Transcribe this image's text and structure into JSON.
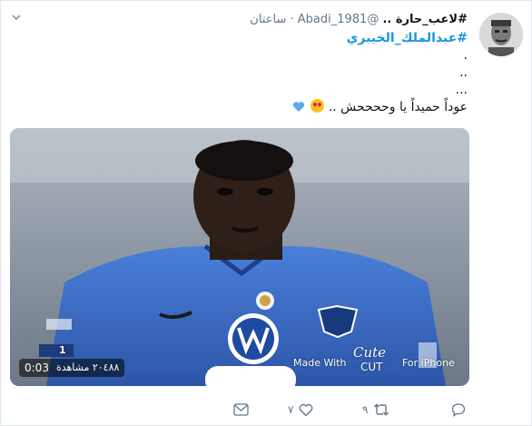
{
  "tweet": {
    "author_name": "#لاعب_حارة ..",
    "handle": "@Abadi_1981",
    "separator": "·",
    "time": "ساعتان",
    "hashtag": "#عبدالملك_الخيبري",
    "line_dot1": ".",
    "line_dot2": "..",
    "line_dot3": "...",
    "message": "عوداً حميداً يا وححححش ..",
    "media": {
      "duration": "0:03",
      "views": "٢٠٤٨٨ مشاهدة",
      "watermark_made_with": "Made With",
      "watermark_cute": "Cute",
      "watermark_cut": "CUT",
      "watermark_for": "For iPhone",
      "jersey_number": "1"
    },
    "actions": {
      "reply_count": "",
      "retweet_count": "٩",
      "like_count": "٧"
    }
  },
  "colors": {
    "link": "#1b95e0",
    "muted": "#657786",
    "jersey": "#3a67c6"
  },
  "icons": [
    "chevron-down-icon",
    "avatar",
    "heart-eyes-emoji",
    "blue-heart-emoji",
    "reply-icon",
    "retweet-icon",
    "like-icon",
    "message-icon"
  ]
}
